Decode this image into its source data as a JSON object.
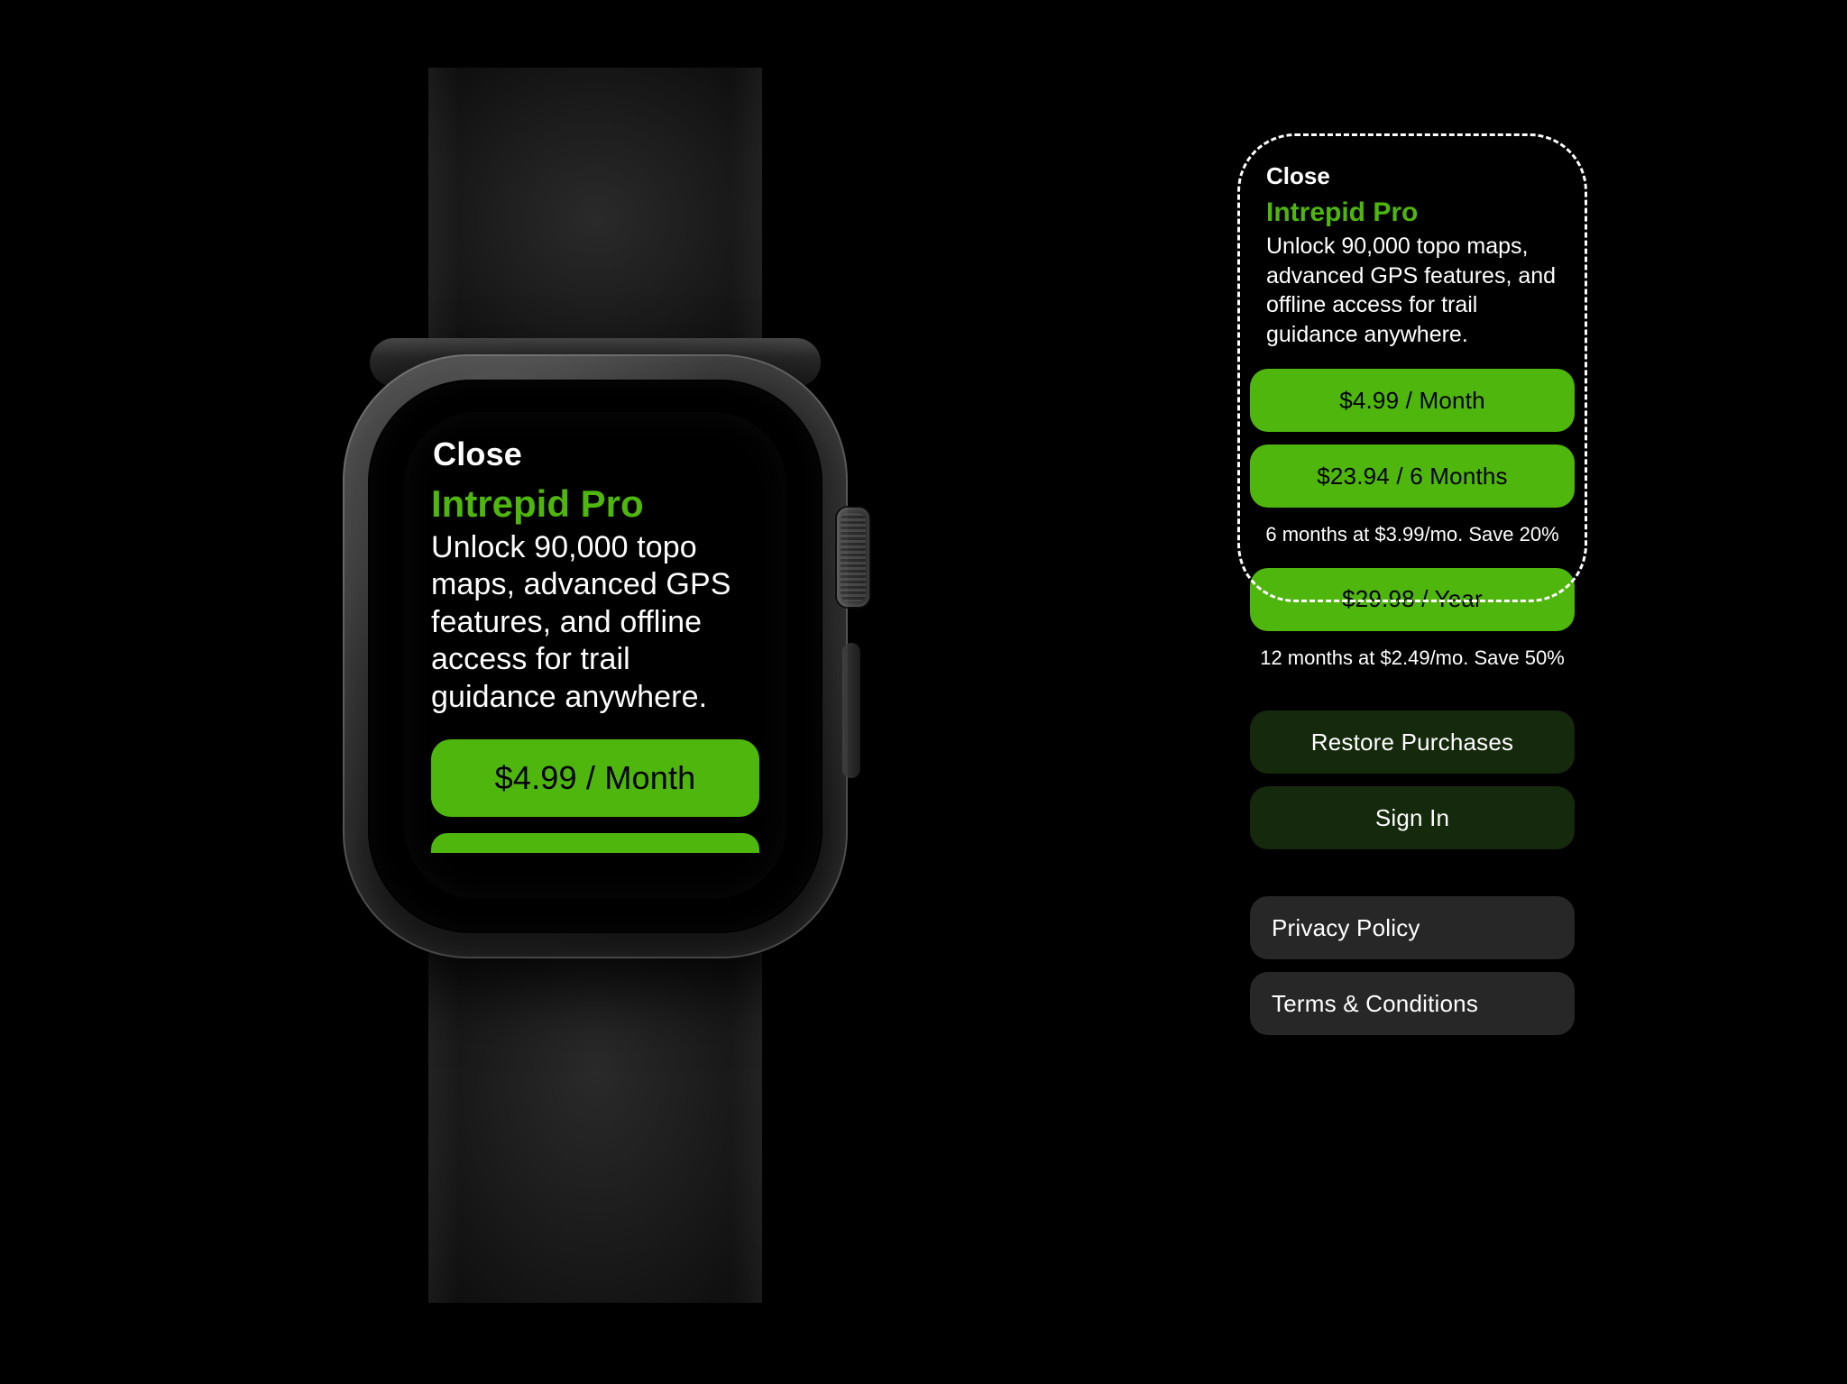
{
  "colors": {
    "accent_green": "#4fb60d",
    "dark_green": "#15290c",
    "dark_gray": "#272727",
    "background": "#000000"
  },
  "watch": {
    "close_label": "Close",
    "title": "Intrepid Pro",
    "description": "Unlock 90,000 topo maps, advanced GPS features, and offline access for trail guidance anywhere.",
    "primary_price_label": "$4.99 / Month"
  },
  "panel": {
    "close_label": "Close",
    "title": "Intrepid Pro",
    "description": "Unlock 90,000 topo maps, advanced GPS features, and offline access for trail guidance anywhere.",
    "plans": [
      {
        "label": "$4.99 / Month",
        "sub": ""
      },
      {
        "label": "$23.94 / 6 Months",
        "sub": "6 months at $3.99/mo. Save 20%"
      },
      {
        "label": "$29.98 / Year",
        "sub": "12 months at $2.49/mo. Save 50%"
      }
    ],
    "restore_label": "Restore Purchases",
    "signin_label": "Sign In",
    "privacy_label": "Privacy Policy",
    "terms_label": "Terms & Conditions"
  }
}
